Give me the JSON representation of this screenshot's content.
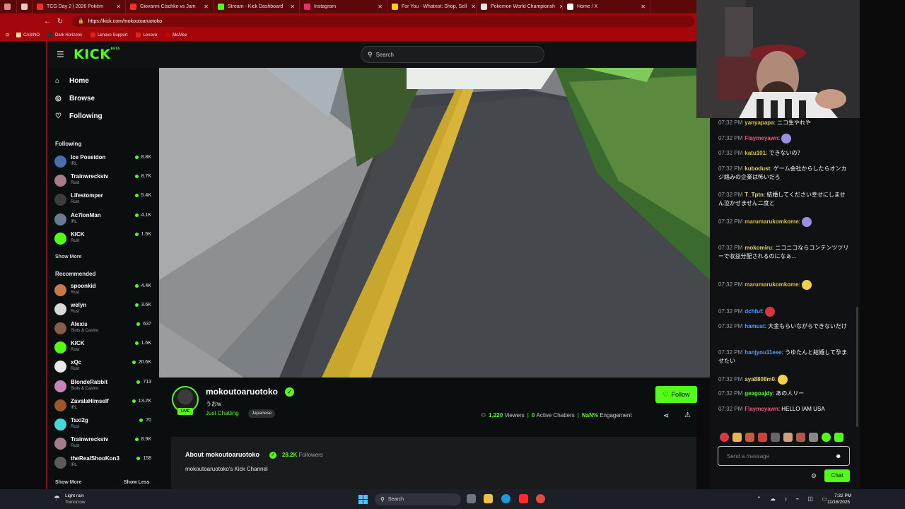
{
  "browser": {
    "tabs": [
      {
        "label": "TCG Day 2 | 2026 Pokém",
        "icon": "youtube-icon",
        "color": "#ff2a2a"
      },
      {
        "label": "Giovanni Cischke vs Jam",
        "icon": "youtube-icon",
        "color": "#ff2a2a"
      },
      {
        "label": "Stream - Kick Dashboard",
        "icon": "kick-icon",
        "color": "#53fc18"
      },
      {
        "label": "Instagram",
        "icon": "instagram-icon",
        "color": "#e1306c"
      },
      {
        "label": "For You - Whatnot: Shop, Sell",
        "icon": "whatnot-icon",
        "color": "#f5d200"
      },
      {
        "label": "Pokemon World Championsh",
        "icon": "pokemon-icon",
        "color": "#e9e9e9"
      },
      {
        "label": "Home / X",
        "icon": "x-icon",
        "color": "#ffffff"
      }
    ],
    "url": "https://kick.com/mokoutoaruotoko",
    "bookmarks": [
      "CASINO",
      "Dark Horizons",
      "Lenovo Support",
      "Lenovo",
      "McAfee"
    ]
  },
  "kick": {
    "logo": "KICK",
    "logo_beta": "BETA",
    "search_placeholder": "Search",
    "nav": {
      "home": "Home",
      "browse": "Browse",
      "following": "Following"
    },
    "following_heading": "Following",
    "following": [
      {
        "name": "Ice Poseidon",
        "category": "IRL",
        "viewers": "8.8K",
        "avatar_color": "#4a6db0"
      },
      {
        "name": "Trainwreckstv",
        "category": "Rust",
        "viewers": "8.7K",
        "avatar_color": "#a87b8a"
      },
      {
        "name": "Lifestomper",
        "category": "Rust",
        "viewers": "5.4K",
        "avatar_color": "#3c3c3c"
      },
      {
        "name": "Ac7ionMan",
        "category": "IRL",
        "viewers": "4.1K",
        "avatar_color": "#6a7b91"
      },
      {
        "name": "KICK",
        "category": "Rust",
        "viewers": "1.5K",
        "avatar_color": "#53fc18"
      }
    ],
    "show_more_1": "Show More",
    "recommended_heading": "Recommended",
    "recommended": [
      {
        "name": "spoonkid",
        "category": "Rust",
        "viewers": "4.4K",
        "avatar_color": "#c57a4a"
      },
      {
        "name": "welyn",
        "category": "Rust",
        "viewers": "3.6K",
        "avatar_color": "#d9d9d9"
      },
      {
        "name": "Alexis",
        "category": "Slots & Casino",
        "viewers": "637",
        "avatar_color": "#8a5a4a"
      },
      {
        "name": "KICK",
        "category": "Rust",
        "viewers": "1.6K",
        "avatar_color": "#53fc18"
      },
      {
        "name": "xQc",
        "category": "Rust",
        "viewers": "20.6K",
        "avatar_color": "#e9e9e9"
      },
      {
        "name": "BlondeRabbit",
        "category": "Slots & Casino",
        "viewers": "713",
        "avatar_color": "#c784b8"
      },
      {
        "name": "ZavalaHimself",
        "category": "IRL",
        "viewers": "13.2K",
        "avatar_color": "#a0552d"
      },
      {
        "name": "Taxi2g",
        "category": "Rust",
        "viewers": "70",
        "avatar_color": "#48d6d9"
      },
      {
        "name": "Trainwreckstv",
        "category": "Rust",
        "viewers": "8.9K",
        "avatar_color": "#a87b8a"
      },
      {
        "name": "theRealShooKon3",
        "category": "IRL",
        "viewers": "158",
        "avatar_color": "#5b5b5b"
      }
    ],
    "show_more_2": "Show More",
    "show_less": "Show Less"
  },
  "stream": {
    "streamer": "mokoutoaruotoko",
    "live_label": "LIVE",
    "title": "うおw",
    "category": "Just Chatting",
    "language": "Japanese",
    "follow_label": "Follow",
    "viewers": "1,220",
    "viewers_label": "Viewers",
    "active_chatters": "0",
    "active_label": "Active Chatters",
    "engagement": "NaN%",
    "engagement_label": "Engagement",
    "about_title": "About mokoutoaruotoko",
    "followers": "28.2K",
    "followers_label": "Followers",
    "description": "mokoutoaruotoko's Kick Channel"
  },
  "chat": {
    "messages": [
      {
        "time": "07:32 PM",
        "user": "yanyapapa",
        "color": "#d8c53a",
        "text": "ニコ生やれや"
      },
      {
        "time": "07:32 PM",
        "user": "Flaymeyawn",
        "color": "#f0557a",
        "text": ""
      },
      {
        "time": "07:32 PM",
        "user": "katu101",
        "color": "#d8c53a",
        "text": "できないの？"
      },
      {
        "time": "07:32 PM",
        "user": "kubodust",
        "color": "#e6d36a",
        "text": "ゲーム会社からしたらオンカジ絡みの企業は怖いだろ"
      },
      {
        "time": "07:32 PM",
        "user": "T_Tptn",
        "color": "#e6d36a",
        "text": "結婚してください幸せにしません泣かせません二度と"
      },
      {
        "time": "07:32 PM",
        "user": "marumarukomkome",
        "color": "#d8c53a",
        "text": ""
      },
      {
        "time": "07:32 PM",
        "user": "mokomiru",
        "color": "#e6d36a",
        "text": "ニコニコならコンテンツツリーで収益分配されるのになぁ..."
      },
      {
        "time": "07:32 PM",
        "user": "marumarukomkome",
        "color": "#d8c53a",
        "text": ""
      },
      {
        "time": "07:32 PM",
        "user": "dchfuf",
        "color": "#4aa3ff",
        "text": ""
      },
      {
        "time": "07:32 PM",
        "user": "hamust",
        "color": "#4aa3ff",
        "text": "大金もらいながらできないだけ"
      },
      {
        "time": "07:32 PM",
        "user": "hanjyou11eee",
        "color": "#4aa3ff",
        "text": "うゆたんと結婚して孕ませたい"
      },
      {
        "time": "07:32 PM",
        "user": "aya8808m0",
        "color": "#e6d36a",
        "text": ""
      },
      {
        "time": "07:32 PM",
        "user": "geagoajdy",
        "color": "#53fc18",
        "text": "あの人リー"
      },
      {
        "time": "07:32 PM",
        "user": "Flaymeyawn",
        "color": "#f0557a",
        "text": "HELLO IAM USA"
      }
    ],
    "input_placeholder": "Send a message",
    "send_label": "Chat"
  },
  "taskbar": {
    "weather_line1": "Light rain",
    "weather_line2": "Tomorrow",
    "search_placeholder": "Search",
    "time": "7:32 PM",
    "date": "11/16/2025"
  }
}
